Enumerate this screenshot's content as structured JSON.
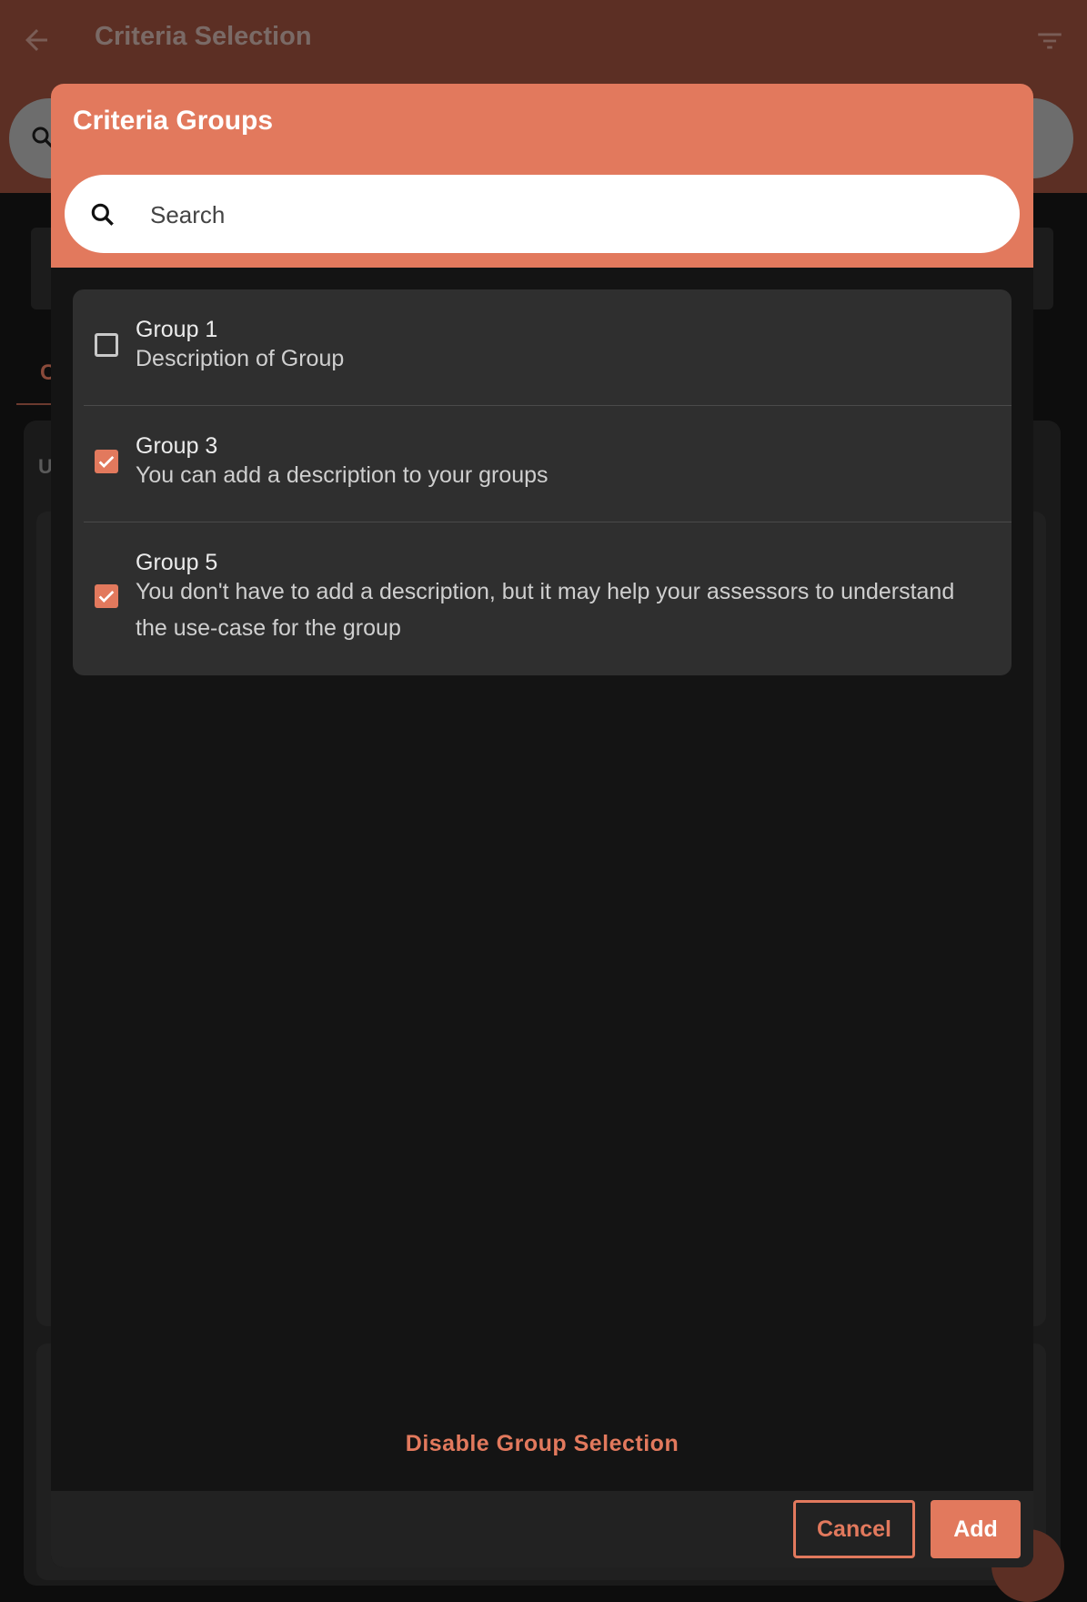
{
  "app": {
    "title": "Criteria Selection",
    "tab_partial": "C",
    "section_partial": "U"
  },
  "dialog": {
    "title": "Criteria Groups",
    "search": {
      "placeholder": "Search",
      "value": ""
    },
    "groups": [
      {
        "title": "Group 1",
        "description": "Description of Group",
        "checked": false
      },
      {
        "title": "Group 3",
        "description": "You can add a description to your groups",
        "checked": true
      },
      {
        "title": "Group 5",
        "description": "You don't have to add a description, but it may help your assessors to understand the use-case for the group",
        "checked": true
      }
    ],
    "disable_label": "Disable Group Selection",
    "cancel_label": "Cancel",
    "add_label": "Add"
  },
  "colors": {
    "accent": "#e2795d",
    "appbar_dimmed": "#5c2f24",
    "dialog_bg": "#141414",
    "list_bg": "#2f2f2f"
  },
  "icons": [
    "arrow-back-icon",
    "filter-icon",
    "search-icon",
    "checkmark-icon"
  ]
}
